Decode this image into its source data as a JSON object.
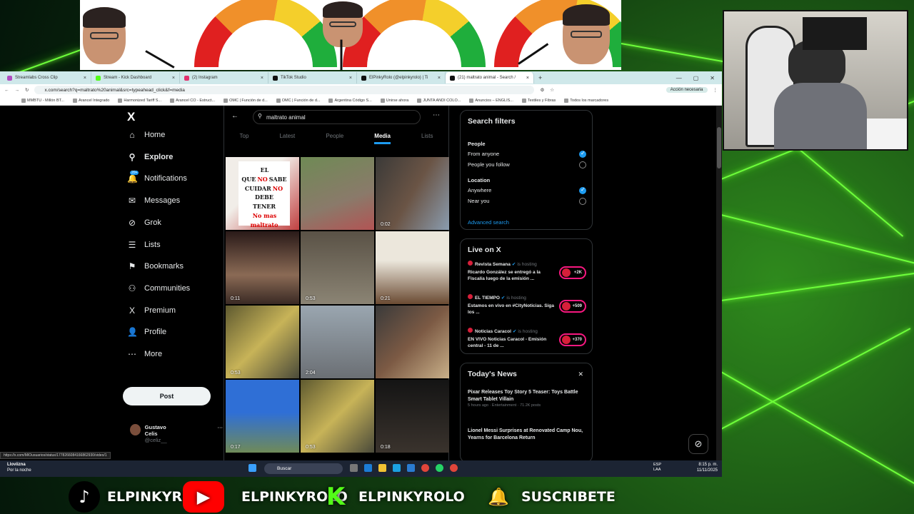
{
  "tabs": [
    {
      "label": "Streamlabs Cross Clip",
      "color": "#b04cc0",
      "active": false
    },
    {
      "label": "Stream - Kick Dashboard",
      "color": "#53fc18",
      "active": false
    },
    {
      "label": "(2) Instagram",
      "color": "#e1306c",
      "active": false
    },
    {
      "label": "TikTok Studio",
      "color": "#111111",
      "active": false
    },
    {
      "label": "ElPinkyRolo (@elpinkyrolo) | Ti",
      "color": "#111111",
      "active": false
    },
    {
      "label": "(21) maltrato animal - Search /",
      "color": "#111111",
      "active": true
    }
  ],
  "address": {
    "url": "x.com/search?q=maltrato%20animal&src=typeahead_click&f=media",
    "account_button": "Acción necesaria"
  },
  "bookmarks": [
    "MMBTU - Millón BT...",
    "Arancel Integrado",
    "Harmonized Tariff S...",
    "Arancel CO - Estruct...",
    "OMC | Función de d...",
    "OMC | Función de d...",
    "Argentina Código S...",
    "Unirse ahora",
    "JUNTA ANDI COLO...",
    "Anuncios – ENGLIS...",
    "Textiles y Fibras",
    "Todos los marcadores"
  ],
  "nav": {
    "logo": "X",
    "items": [
      {
        "label": "Home",
        "icon": "⌂"
      },
      {
        "label": "Explore",
        "icon": "⚲"
      },
      {
        "label": "Notifications",
        "icon": "🔔"
      },
      {
        "label": "Messages",
        "icon": "✉"
      },
      {
        "label": "Grok",
        "icon": "⊘"
      },
      {
        "label": "Lists",
        "icon": "☰"
      },
      {
        "label": "Bookmarks",
        "icon": "⚑"
      },
      {
        "label": "Communities",
        "icon": "⚇"
      },
      {
        "label": "Premium",
        "icon": "X"
      },
      {
        "label": "Profile",
        "icon": "👤"
      },
      {
        "label": "More",
        "icon": "⋯"
      }
    ],
    "notif_badge": "20+",
    "post": "Post",
    "user_name": "Gustavo Celis",
    "user_handle": "@celiz__",
    "status_url": "https://x.com/MIOusuarios/status/1778266084166862930/video/1"
  },
  "search": {
    "query": "maltrato animal",
    "tabs": [
      "Top",
      "Latest",
      "People",
      "Media",
      "Lists"
    ],
    "active_tab": "Media"
  },
  "media": [
    {
      "dur": "",
      "bg": "linear-gradient(135deg,#f1ede8 40%,#c04040)"
    },
    {
      "dur": "",
      "bg": "linear-gradient(160deg,#6f8a55,#8a7a6a 60%,#b25454)"
    },
    {
      "dur": "0:02",
      "bg": "linear-gradient(120deg,#3b3a38,#6a5445 50%,#8a9caf)"
    },
    {
      "dur": "0:11",
      "bg": "linear-gradient(180deg,#2a1a18,#8a6a55 60%,#3a2a24)"
    },
    {
      "dur": "0:53",
      "bg": "linear-gradient(180deg,#5a5246,#8b8474)"
    },
    {
      "dur": "0:21",
      "bg": "linear-gradient(180deg,#ece7dc 40%,#6a4a32)"
    },
    {
      "dur": "0:53",
      "bg": "linear-gradient(135deg,#5f5a30,#c7b358 50%,#4a4a3a)"
    },
    {
      "dur": "2:04",
      "bg": "linear-gradient(180deg,#9aa6b0,#6b6f74)"
    },
    {
      "dur": "",
      "bg": "linear-gradient(135deg,#3a3a3a,#7c5a44 50%,#c9b089)"
    },
    {
      "dur": "0:17",
      "bg": "linear-gradient(180deg,#2f6fd6 45%,#6f8a58)"
    },
    {
      "dur": "0:53",
      "bg": "linear-gradient(135deg,#5f5a30,#c7b358 50%,#4a4a3a)"
    },
    {
      "dur": "0:18",
      "bg": "linear-gradient(180deg,#141414,#3a332d)"
    }
  ],
  "sign": {
    "line1": "EL QUE",
    "no1": "NO",
    "line2": "SABE CUIDAR",
    "no2": "NO",
    "line3": "DEBE",
    "line4": "TENER",
    "bottom": "No mas maltrato animal"
  },
  "filters": {
    "title": "Search filters",
    "people_label": "People",
    "people": [
      {
        "label": "From anyone",
        "on": true
      },
      {
        "label": "People you follow",
        "on": false
      }
    ],
    "location_label": "Location",
    "location": [
      {
        "label": "Anywhere",
        "on": true
      },
      {
        "label": "Near you",
        "on": false
      }
    ],
    "advanced": "Advanced search"
  },
  "live": {
    "title": "Live on X",
    "hosting": "is hosting",
    "items": [
      {
        "host": "Revista Semana",
        "text": "Ricardo González se entregó a la Fiscalía luego de la emisión ...",
        "count": "+2K"
      },
      {
        "host": "EL TIEMPO",
        "text": "Estamos en vivo en #CityNoticias. Siga los ...",
        "count": "+509"
      },
      {
        "host": "Noticias Caracol",
        "text": "EN VIVO Noticias Caracol - Emisión central - 11 de ...",
        "count": "+370"
      }
    ]
  },
  "news": {
    "title": "Today's News",
    "items": [
      {
        "headline": "Pixar Releases Toy Story 5 Teaser: Toys Battle Smart Tablet Villain",
        "meta": "5 hours ago · Entertainment · 71.2K posts"
      },
      {
        "headline": "Lionel Messi Surprises at Renovated Camp Nou, Yearns for Barcelona Return",
        "meta": ""
      }
    ]
  },
  "taskbar": {
    "weather": "Lloviizna",
    "weather_sub": "Por la noche",
    "search": "Buscar",
    "lang1": "ESP",
    "lang2": "LAA",
    "time": "8:15 p. m.",
    "date": "11/11/2025"
  },
  "social": [
    {
      "name": "ELPINKYROLO",
      "icon": "tiktok"
    },
    {
      "name": "ELPINKYROLO",
      "icon": "youtube"
    },
    {
      "name": "ELPINKYROLO",
      "icon": "kick"
    },
    {
      "name": "SUSCRIBETE",
      "icon": "bell"
    }
  ]
}
